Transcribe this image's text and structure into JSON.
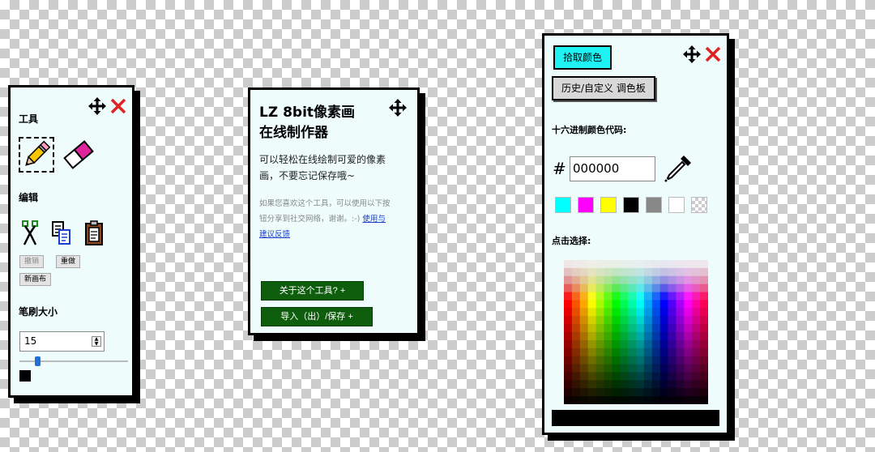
{
  "tools_panel": {
    "tools_heading": "工具",
    "edit_heading": "编辑",
    "undo_label": "撤销",
    "redo_label": "重做",
    "new_canvas_label": "新画布",
    "brush_heading": "笔刷大小",
    "brush_size_value": "15",
    "brush_size_fraction": 0.15
  },
  "info_panel": {
    "title_line1": "LZ 8bit像素画",
    "title_line2": "在线制作器",
    "description_line1": "可以轻松在线绘制可爱的像素",
    "description_line2": "画，不要忘记保存哦~",
    "note_line1": "如果您喜欢这个工具，可以使用以下按",
    "note_line2": "钮分享到社交网络，谢谢。:-)",
    "feedback_link_part1": "使用与",
    "feedback_link_part2": "建议反馈",
    "about_button": "关于这个工具? +",
    "import_button": "导入（出）/保存 +"
  },
  "color_panel": {
    "pick_color_tab": "拾取颜色",
    "history_tab": "历史/自定义 调色板",
    "hex_heading": "十六进制颜色代码:",
    "hash_symbol": "#",
    "hex_value": "000000",
    "click_select_heading": "点击选择:",
    "swatches": [
      "#00ffff",
      "#ff00ff",
      "#ffff00",
      "#000000",
      "#888888",
      "#ffffff",
      "transparent"
    ],
    "current_color": "#000000"
  }
}
